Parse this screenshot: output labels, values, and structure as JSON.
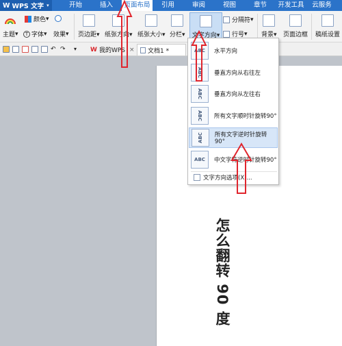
{
  "app": {
    "brand": "WPS 文字",
    "accent": "#2b73c9"
  },
  "menu": {
    "items": [
      "开始",
      "插入",
      "页面布局",
      "引用",
      "审阅",
      "视图",
      "章节",
      "开发工具",
      "云服务"
    ],
    "active": "页面布局"
  },
  "ribbon": {
    "theme": "主题",
    "color": "颜色",
    "font": "字体",
    "effects": "效果",
    "margins": "页边距",
    "orientation": "纸张方向",
    "size": "纸张大小",
    "columns": "分栏",
    "text_direction": "文字方向",
    "separator": "分隔符",
    "line_numbers": "行号",
    "background": "背景",
    "page_border": "页面边框",
    "manuscript": "稿纸设置"
  },
  "tabs": {
    "my_wps": "我的WPS",
    "document": "文档1 *"
  },
  "dropdown": {
    "items": [
      {
        "label": "水平方向",
        "icon": "ABC"
      },
      {
        "label": "垂直方向从右往左",
        "icon": "ABC"
      },
      {
        "label": "垂直方向从左往右",
        "icon": "ABC"
      },
      {
        "label": "所有文字顺时针旋转90°",
        "icon": "ABC"
      },
      {
        "label": "所有文字逆时针旋转90°",
        "icon": "ABC"
      },
      {
        "label": "中文字符逆时针旋转90°",
        "icon": "ABC"
      }
    ],
    "options": "文字方向选项(X)..."
  },
  "document_text": "怎么翻转 90 度"
}
